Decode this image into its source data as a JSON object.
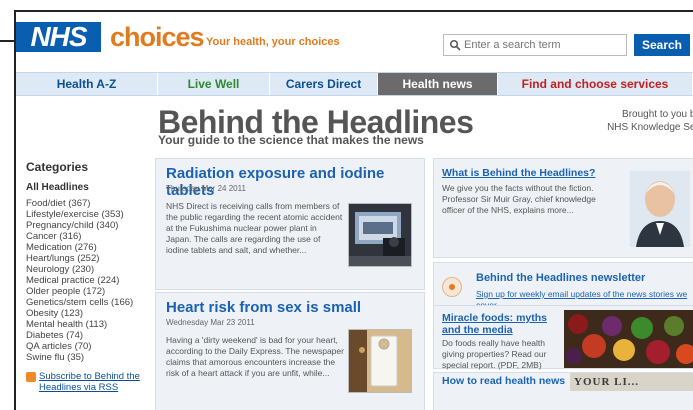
{
  "header": {
    "logo_nhs": "NHS",
    "logo_choices": "choices",
    "tagline": "Your health, your choices",
    "search_placeholder": "Enter a search term",
    "search_button": "Search"
  },
  "nav": [
    {
      "label": "Health A-Z"
    },
    {
      "label": "Live Well"
    },
    {
      "label": "Carers Direct"
    },
    {
      "label": "Health news"
    },
    {
      "label": "Find and choose services"
    }
  ],
  "page": {
    "title": "Behind the Headlines",
    "subtitle": "Your guide to the science that makes the news",
    "brought_line1": "Brought to you by t",
    "brought_line2": "NHS Knowledge Servi"
  },
  "sidebar": {
    "heading": "Categories",
    "all": "All Headlines",
    "items": [
      "Food/diet (367)",
      "Lifestyle/exercise (353)",
      "Pregnancy/child (340)",
      "Cancer (316)",
      "Medication (276)",
      "Heart/lungs (252)",
      "Neurology (230)",
      "Medical practice (224)",
      "Older people (172)",
      "Genetics/stem cells (166)",
      "Obesity (123)",
      "Mental health (113)",
      "Diabetes (74)",
      "QA articles (70)",
      "Swine flu (35)"
    ],
    "rss_line1": "Subscribe to Behind the",
    "rss_line2": "Headlines via RSS"
  },
  "articles": [
    {
      "title": "Radiation exposure and iodine tablets",
      "date": "Thursday Mar 24 2011",
      "body": "NHS Direct is receiving calls from members of the public regarding the recent atomic accident at the Fukushima nuclear power plant in Japan. The calls are regarding the use of iodine tablets and salt, and whether..."
    },
    {
      "title": "Heart risk from sex is small",
      "date": "Wednesday Mar 23 2011",
      "body": "Having a 'dirty weekend' is bad for your heart, according to the Daily Express. The newspaper claims that amorous encounters increase the risk of a heart attack if you are unfit, while..."
    }
  ],
  "panels": {
    "what": {
      "title": "What is Behind the Headlines?",
      "body": "We give you the facts without the fiction. Professor Sir Muir Gray, chief knowledge officer of the NHS, explains more..."
    },
    "newsletter": {
      "title": "Behind the Headlines newsletter",
      "body": "Sign up for weekly email updates of the news stories we cover"
    },
    "miracle": {
      "title": "Miracle foods: myths and the media",
      "body": "Do foods really have health giving properties? Read our special report. (PDF, 2MB)"
    },
    "howto": {
      "title": "How to read health news",
      "image_text": "YOUR LI..."
    }
  }
}
